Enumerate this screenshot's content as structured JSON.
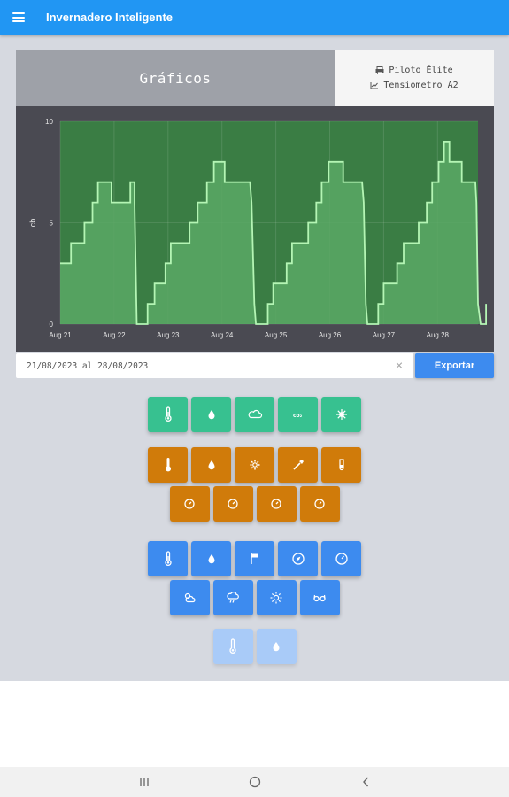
{
  "app": {
    "title": "Invernadero Inteligente"
  },
  "header": {
    "title": "Gráficos",
    "device_line1": "Piloto Élite",
    "device_line2": "Tensiometro A2"
  },
  "chart_data": {
    "type": "area",
    "x_tick_labels": [
      "Aug 21",
      "Aug 22",
      "Aug 23",
      "Aug 24",
      "Aug 25",
      "Aug 26",
      "Aug 27",
      "Aug 28"
    ],
    "y_ticks": [
      0,
      5,
      10
    ],
    "ylabel": "cb",
    "ylim": [
      0,
      10
    ],
    "x_range_days": [
      0,
      7.75
    ],
    "grid": true,
    "colors": {
      "plot_bg": "#3a7d44",
      "fill": "#5aa865",
      "line": "#b4f5b4"
    },
    "series": [
      {
        "values": [
          [
            0,
            3
          ],
          [
            0.2,
            3
          ],
          [
            0.2,
            4
          ],
          [
            0.45,
            4
          ],
          [
            0.45,
            5
          ],
          [
            0.6,
            5
          ],
          [
            0.6,
            6
          ],
          [
            0.7,
            6
          ],
          [
            0.7,
            7
          ],
          [
            0.95,
            7
          ],
          [
            0.95,
            6
          ],
          [
            1.3,
            6
          ],
          [
            1.3,
            7
          ],
          [
            1.38,
            7
          ],
          [
            1.38,
            6
          ],
          [
            1.42,
            0
          ],
          [
            1.62,
            0
          ],
          [
            1.62,
            1
          ],
          [
            1.75,
            1
          ],
          [
            1.75,
            2
          ],
          [
            1.95,
            2
          ],
          [
            1.95,
            3
          ],
          [
            2.05,
            3
          ],
          [
            2.05,
            4
          ],
          [
            2.4,
            4
          ],
          [
            2.4,
            5
          ],
          [
            2.55,
            5
          ],
          [
            2.55,
            6
          ],
          [
            2.72,
            6
          ],
          [
            2.72,
            7
          ],
          [
            2.85,
            7
          ],
          [
            2.85,
            8
          ],
          [
            3.05,
            8
          ],
          [
            3.05,
            7
          ],
          [
            3.52,
            7
          ],
          [
            3.55,
            6
          ],
          [
            3.6,
            1
          ],
          [
            3.63,
            0
          ],
          [
            3.85,
            0
          ],
          [
            3.85,
            1
          ],
          [
            3.95,
            1
          ],
          [
            3.95,
            2
          ],
          [
            4.2,
            2
          ],
          [
            4.2,
            3
          ],
          [
            4.3,
            3
          ],
          [
            4.3,
            4
          ],
          [
            4.6,
            4
          ],
          [
            4.6,
            5
          ],
          [
            4.75,
            5
          ],
          [
            4.75,
            6
          ],
          [
            4.85,
            6
          ],
          [
            4.85,
            7
          ],
          [
            4.98,
            7
          ],
          [
            4.98,
            8
          ],
          [
            5.25,
            8
          ],
          [
            5.25,
            7
          ],
          [
            5.6,
            7
          ],
          [
            5.63,
            6
          ],
          [
            5.67,
            1
          ],
          [
            5.7,
            0
          ],
          [
            5.9,
            0
          ],
          [
            5.9,
            1
          ],
          [
            6.0,
            1
          ],
          [
            6.0,
            2
          ],
          [
            6.25,
            2
          ],
          [
            6.25,
            3
          ],
          [
            6.37,
            3
          ],
          [
            6.37,
            4
          ],
          [
            6.65,
            4
          ],
          [
            6.65,
            5
          ],
          [
            6.8,
            5
          ],
          [
            6.8,
            6
          ],
          [
            6.9,
            6
          ],
          [
            6.9,
            7
          ],
          [
            7.02,
            7
          ],
          [
            7.02,
            8
          ],
          [
            7.12,
            8
          ],
          [
            7.12,
            9
          ],
          [
            7.22,
            9
          ],
          [
            7.22,
            8
          ],
          [
            7.45,
            8
          ],
          [
            7.45,
            7
          ],
          [
            7.7,
            7
          ],
          [
            7.72,
            6
          ],
          [
            7.75,
            1
          ],
          [
            7.8,
            0
          ],
          [
            7.9,
            0
          ],
          [
            7.9,
            1
          ]
        ]
      }
    ]
  },
  "date_range": {
    "value": "21/08/2023 al 28/08/2023",
    "clear_icon": "close-icon"
  },
  "export_button": {
    "label": "Exportar"
  },
  "colors": {
    "appbar": "#2196f3",
    "green": "#37c190",
    "orange": "#d07b0a",
    "blue": "#3d8bef",
    "lightblue": "#a9cbf8"
  },
  "sensor_groups": {
    "green": [
      "thermometer-icon",
      "water-drop-icon",
      "cloud-icon",
      "co2-icon",
      "virus-icon"
    ],
    "orange_row1": [
      "thermometer-icon",
      "water-drop-icon",
      "gear-icon",
      "pipette-icon",
      "test-tube-icon"
    ],
    "orange_row2": [
      "gauge-icon",
      "gauge-icon",
      "gauge-icon",
      "gauge-icon"
    ],
    "blue_row1": [
      "thermometer-icon",
      "water-drop-icon",
      "wind-flag-icon",
      "compass-icon",
      "gauge-icon"
    ],
    "blue_row2": [
      "partly-cloudy-icon",
      "rain-cloud-icon",
      "sun-icon",
      "goggles-icon"
    ],
    "light_row": [
      "thermometer-icon",
      "water-drop-icon"
    ]
  }
}
